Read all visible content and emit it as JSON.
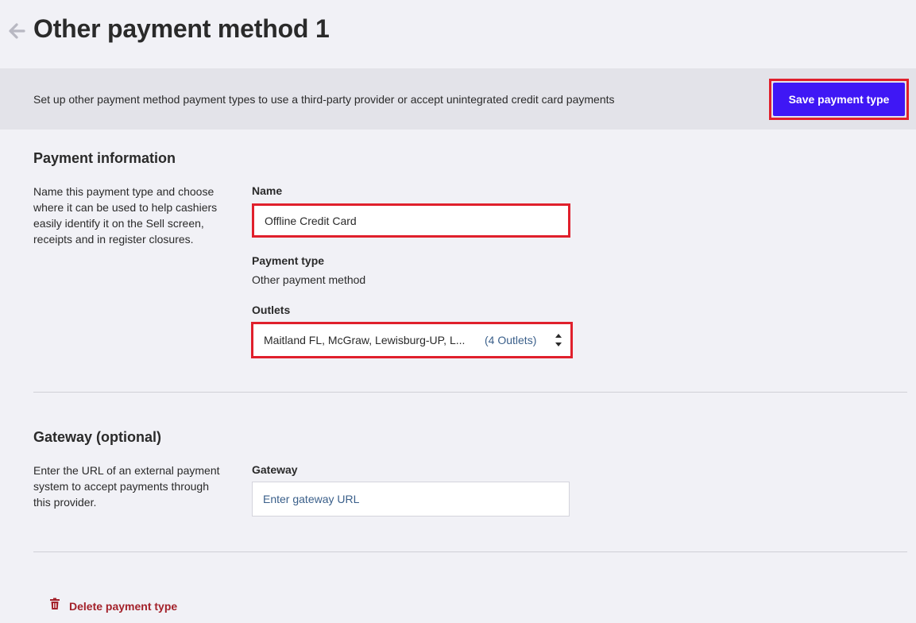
{
  "header": {
    "title": "Other payment method 1",
    "back_icon": "arrow-left-icon"
  },
  "banner": {
    "description": "Set up other payment method payment types to use a third-party provider or accept unintegrated credit card payments",
    "save_label": "Save payment type",
    "accent_color": "#3f17f5"
  },
  "payment_info": {
    "title": "Payment information",
    "description": "Name this payment type and choose where it can be used to help cashiers easily identify it on the Sell screen, receipts and in register closures.",
    "name_label": "Name",
    "name_value": "Offline Credit Card",
    "type_label": "Payment type",
    "type_value": "Other payment method",
    "outlets_label": "Outlets",
    "outlets_value": "Maitland FL, McGraw, Lewisburg-UP, L...",
    "outlets_count": "(4 Outlets)"
  },
  "gateway": {
    "title": "Gateway (optional)",
    "description": "Enter the URL of an external payment system to accept payments through this provider.",
    "label": "Gateway",
    "placeholder": "Enter gateway URL"
  },
  "footer": {
    "delete_label": "Delete payment type",
    "delete_icon": "trash-icon",
    "delete_color": "#a3212a"
  }
}
